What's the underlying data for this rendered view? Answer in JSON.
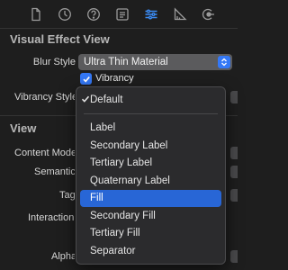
{
  "toolbar": {
    "icons": [
      "document-icon",
      "clock-icon",
      "help-icon",
      "identity-icon",
      "attributes-icon",
      "ruler-icon",
      "connections-icon"
    ],
    "active_index": 4,
    "accent": "#3b8cf5"
  },
  "visual_effect": {
    "title": "Visual Effect View",
    "blur_style_label": "Blur Style",
    "blur_style_value": "Ultra Thin Material",
    "vibrancy_checked": true,
    "vibrancy_label": "Vibrancy",
    "vibrancy_style_label": "Vibrancy Style"
  },
  "view": {
    "title": "View",
    "rows": [
      "Content Mode",
      "Semantic",
      "Tag",
      "Interaction",
      "Alpha"
    ]
  },
  "menu": {
    "checked_item": "Default",
    "header_item": "Default",
    "items": [
      "Label",
      "Secondary Label",
      "Tertiary Label",
      "Quaternary Label",
      "Fill",
      "Secondary Fill",
      "Tertiary Fill",
      "Separator"
    ],
    "selected_item": "Fill",
    "highlight_color": "#2866d6"
  }
}
